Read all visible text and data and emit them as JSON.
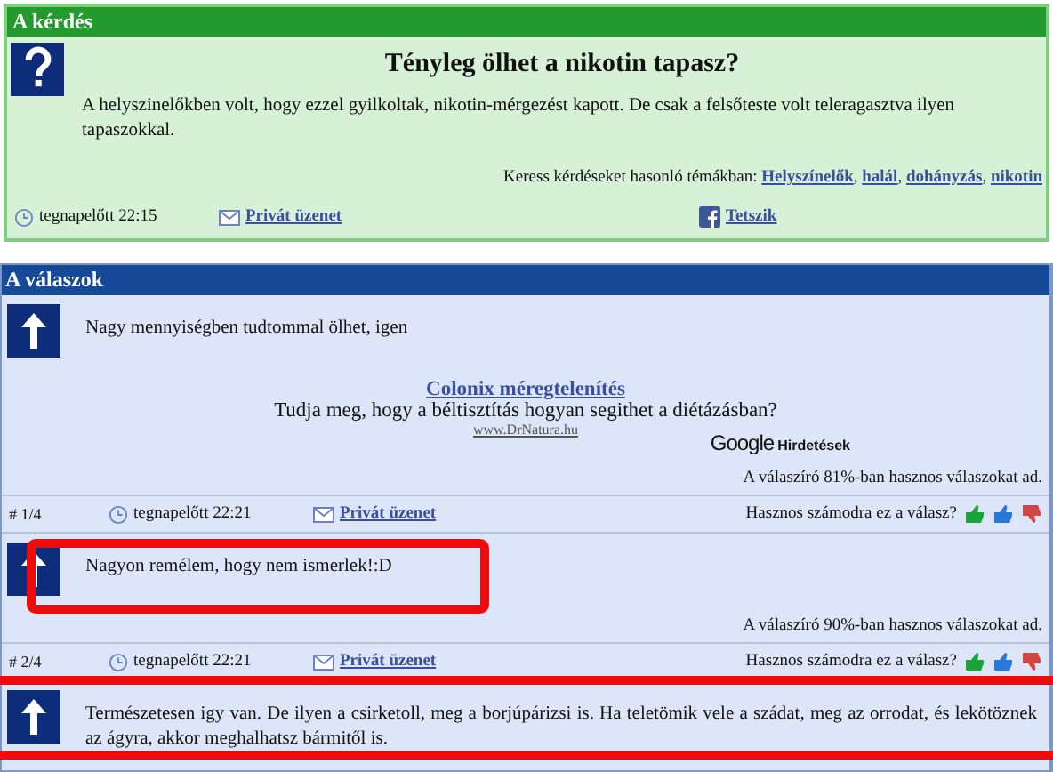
{
  "question": {
    "header": "A kérdés",
    "title": "Tényleg ölhet a nikotin tapasz?",
    "body": "A helyszinelőkben volt, hogy ezzel gyilkoltak, nikotin-mérgezést kapott. De csak a felsőteste volt teleragasztva ilyen tapaszokkal.",
    "tags_label": "Keress kérdéseket hasonló témákban:",
    "tag_separator": ",",
    "tags": [
      "Helyszínelők",
      "halál",
      "dohányzás",
      "nikotin"
    ],
    "time": "tegnapelőtt 22:15",
    "message_link": "Privát üzenet",
    "like_link": "Tetszik"
  },
  "answers_header": "A válaszok",
  "answers": [
    {
      "text": "Nagy mennyiségben tudtommal ölhet, igen",
      "highlight_box": false,
      "highlight_band": false,
      "ad": {
        "title": "Colonix méregtelenítés",
        "description": "Tudja meg, hogy a béltisztítás hogyan segithet a diétázásban?",
        "url": "www.DrNatura.hu",
        "brand": "Google",
        "brand_label": "Hirdetések"
      },
      "rating": "A válaszíró 81%-ban hasznos válaszokat ad.",
      "index": "# 1/4",
      "time": "tegnapelőtt 22:21",
      "message_link": "Privát üzenet",
      "useful_question": "Hasznos számodra ez a válasz?"
    },
    {
      "text": "Nagyon remélem, hogy nem ismerlek!:D",
      "highlight_box": true,
      "highlight_band": false,
      "rating": "A válaszíró 90%-ban hasznos válaszokat ad.",
      "index": "# 2/4",
      "time": "tegnapelőtt 22:21",
      "message_link": "Privát üzenet",
      "useful_question": "Hasznos számodra ez a válasz?"
    },
    {
      "text": "Természetesen igy van. De ilyen a csirketoll, meg a borjúpárizsi is. Ha teletömik vele a szádat, meg az orrodat, és lekötöznek az ágyra, akkor meghalhatsz bármitől is.",
      "highlight_box": false,
      "highlight_band": true
    }
  ]
}
